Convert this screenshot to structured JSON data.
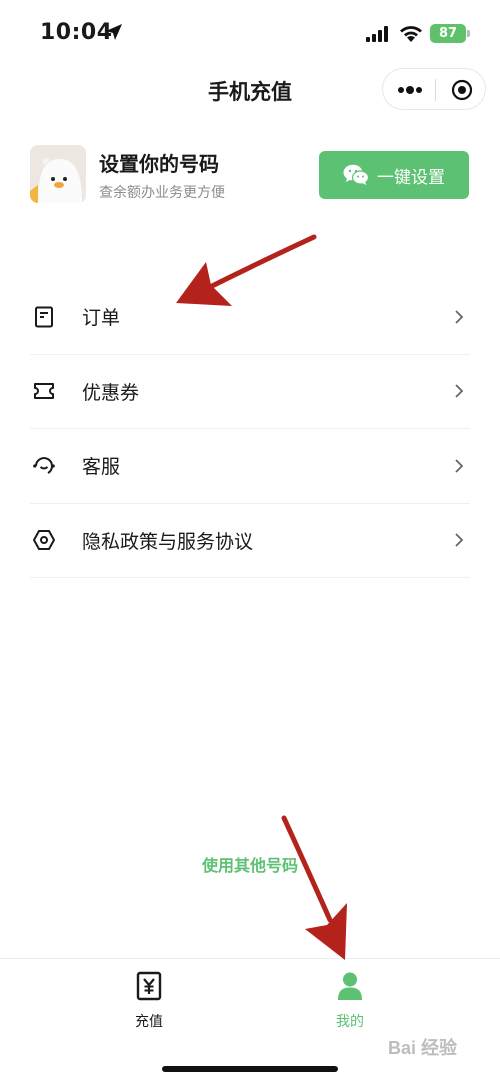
{
  "status_bar": {
    "time": "10:04",
    "battery": "87"
  },
  "nav": {
    "title": "手机充值"
  },
  "profile": {
    "title": "设置你的号码",
    "subtitle": "查余额办业务更方便",
    "button_label": "一键设置"
  },
  "menu": {
    "items": [
      {
        "label": "订单",
        "icon": "order-icon"
      },
      {
        "label": "优惠券",
        "icon": "coupon-icon"
      },
      {
        "label": "客服",
        "icon": "customer-service-icon"
      },
      {
        "label": "隐私政策与服务协议",
        "icon": "privacy-icon"
      }
    ]
  },
  "other_number_link": "使用其他号码",
  "tabs": [
    {
      "label": "充值",
      "icon": "yen-bill-icon",
      "active": false
    },
    {
      "label": "我的",
      "icon": "user-icon",
      "active": true
    }
  ],
  "watermark": "Bai 经验",
  "colors": {
    "accent": "#5cc172",
    "annotation_arrow": "#b3231c"
  }
}
